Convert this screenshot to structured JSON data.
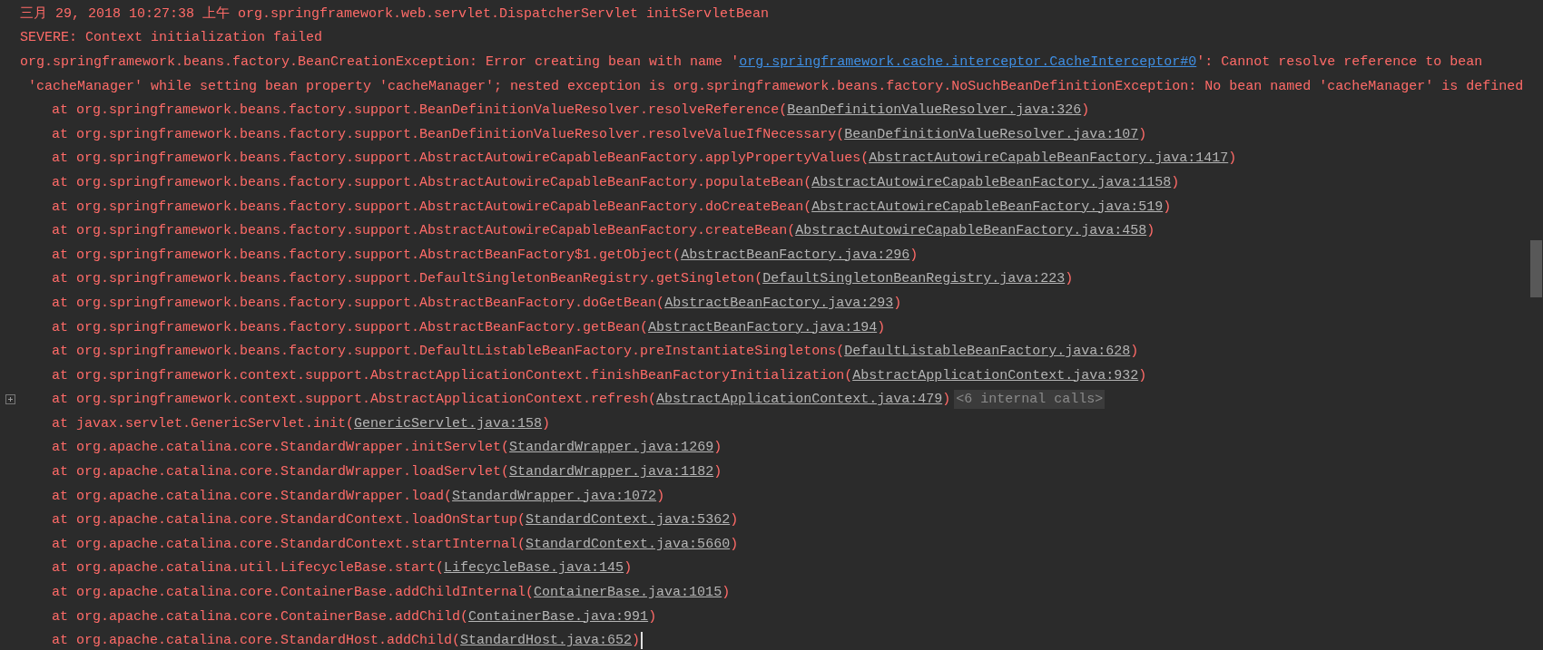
{
  "console": {
    "lines": [
      {
        "kind": "text",
        "text": "三月 29, 2018 10:27:38 上午 org.springframework.web.servlet.DispatcherServlet initServletBean"
      },
      {
        "kind": "text",
        "text": "SEVERE: Context initialization failed"
      },
      {
        "kind": "exception",
        "before": "org.springframework.beans.factory.BeanCreationException: Error creating bean with name '",
        "link": "org.springframework.cache.interceptor.CacheInterceptor#0",
        "after": "': Cannot resolve reference to bean"
      },
      {
        "kind": "continuation",
        "text": "'cacheManager' while setting bean property 'cacheManager'; nested exception is org.springframework.beans.factory.NoSuchBeanDefinitionException: No bean named 'cacheManager' is defined"
      },
      {
        "kind": "frame",
        "call": "at org.springframework.beans.factory.support.BeanDefinitionValueResolver.resolveReference(",
        "location": "BeanDefinitionValueResolver.java:326",
        "end": ")"
      },
      {
        "kind": "frame",
        "call": "at org.springframework.beans.factory.support.BeanDefinitionValueResolver.resolveValueIfNecessary(",
        "location": "BeanDefinitionValueResolver.java:107",
        "end": ")"
      },
      {
        "kind": "frame",
        "call": "at org.springframework.beans.factory.support.AbstractAutowireCapableBeanFactory.applyPropertyValues(",
        "location": "AbstractAutowireCapableBeanFactory.java:1417",
        "end": ")"
      },
      {
        "kind": "frame",
        "call": "at org.springframework.beans.factory.support.AbstractAutowireCapableBeanFactory.populateBean(",
        "location": "AbstractAutowireCapableBeanFactory.java:1158",
        "end": ")"
      },
      {
        "kind": "frame",
        "call": "at org.springframework.beans.factory.support.AbstractAutowireCapableBeanFactory.doCreateBean(",
        "location": "AbstractAutowireCapableBeanFactory.java:519",
        "end": ")"
      },
      {
        "kind": "frame",
        "call": "at org.springframework.beans.factory.support.AbstractAutowireCapableBeanFactory.createBean(",
        "location": "AbstractAutowireCapableBeanFactory.java:458",
        "end": ")"
      },
      {
        "kind": "frame",
        "call": "at org.springframework.beans.factory.support.AbstractBeanFactory$1.getObject(",
        "location": "AbstractBeanFactory.java:296",
        "end": ")"
      },
      {
        "kind": "frame",
        "call": "at org.springframework.beans.factory.support.DefaultSingletonBeanRegistry.getSingleton(",
        "location": "DefaultSingletonBeanRegistry.java:223",
        "end": ")"
      },
      {
        "kind": "frame",
        "call": "at org.springframework.beans.factory.support.AbstractBeanFactory.doGetBean(",
        "location": "AbstractBeanFactory.java:293",
        "end": ")"
      },
      {
        "kind": "frame",
        "call": "at org.springframework.beans.factory.support.AbstractBeanFactory.getBean(",
        "location": "AbstractBeanFactory.java:194",
        "end": ")"
      },
      {
        "kind": "frame",
        "call": "at org.springframework.beans.factory.support.DefaultListableBeanFactory.preInstantiateSingletons(",
        "location": "DefaultListableBeanFactory.java:628",
        "end": ")"
      },
      {
        "kind": "frame",
        "call": "at org.springframework.context.support.AbstractApplicationContext.finishBeanFactoryInitialization(",
        "location": "AbstractApplicationContext.java:932",
        "end": ")"
      },
      {
        "kind": "frame",
        "call": "at org.springframework.context.support.AbstractApplicationContext.refresh(",
        "location": "AbstractApplicationContext.java:479",
        "end": ")",
        "folded": "<6 internal calls>"
      },
      {
        "kind": "frame",
        "call": "at javax.servlet.GenericServlet.init(",
        "location": "GenericServlet.java:158",
        "end": ")"
      },
      {
        "kind": "frame",
        "call": "at org.apache.catalina.core.StandardWrapper.initServlet(",
        "location": "StandardWrapper.java:1269",
        "end": ")"
      },
      {
        "kind": "frame",
        "call": "at org.apache.catalina.core.StandardWrapper.loadServlet(",
        "location": "StandardWrapper.java:1182",
        "end": ")"
      },
      {
        "kind": "frame",
        "call": "at org.apache.catalina.core.StandardWrapper.load(",
        "location": "StandardWrapper.java:1072",
        "end": ")"
      },
      {
        "kind": "frame",
        "call": "at org.apache.catalina.core.StandardContext.loadOnStartup(",
        "location": "StandardContext.java:5362",
        "end": ")"
      },
      {
        "kind": "frame",
        "call": "at org.apache.catalina.core.StandardContext.startInternal(",
        "location": "StandardContext.java:5660",
        "end": ")"
      },
      {
        "kind": "frame",
        "call": "at org.apache.catalina.util.LifecycleBase.start(",
        "location": "LifecycleBase.java:145",
        "end": ")"
      },
      {
        "kind": "frame",
        "call": "at org.apache.catalina.core.ContainerBase.addChildInternal(",
        "location": "ContainerBase.java:1015",
        "end": ")"
      },
      {
        "kind": "frame",
        "call": "at org.apache.catalina.core.ContainerBase.addChild(",
        "location": "ContainerBase.java:991",
        "end": ")"
      },
      {
        "kind": "frame",
        "call": "at org.apache.catalina.core.StandardHost.addChild(",
        "location": "StandardHost.java:652",
        "end": ")",
        "caret": true
      }
    ]
  }
}
